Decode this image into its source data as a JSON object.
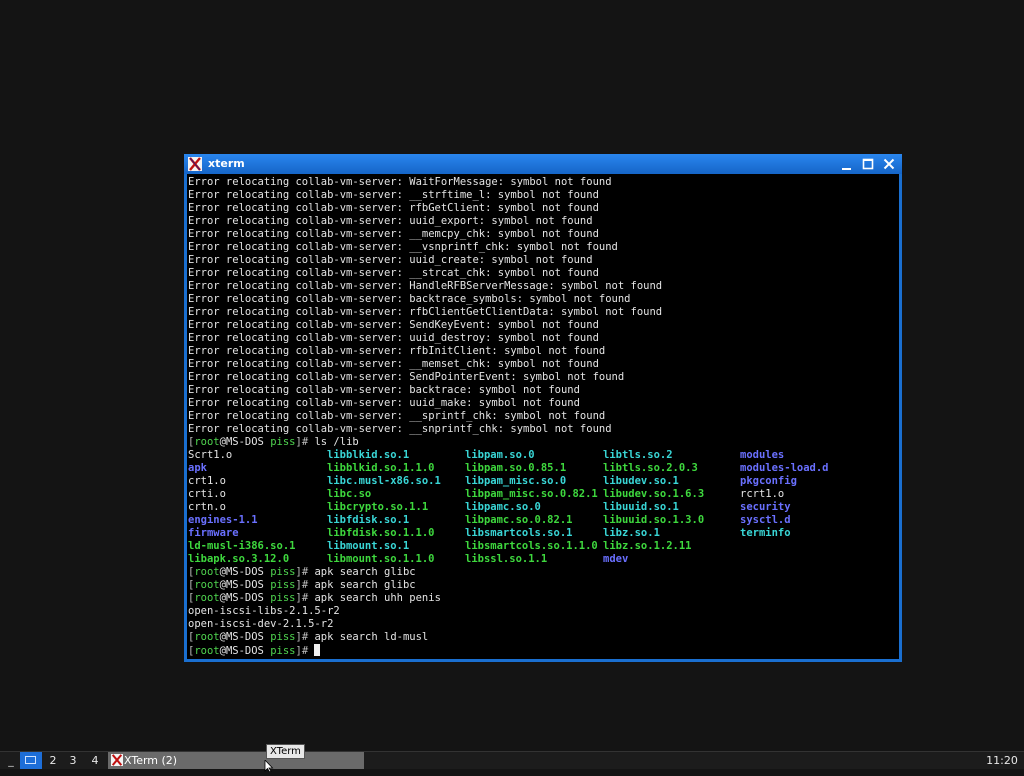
{
  "window": {
    "title": "xterm",
    "icon": "xterm-x-icon",
    "buttons": [
      "minimize",
      "maximize",
      "close"
    ]
  },
  "terminal": {
    "errors": [
      "Error relocating collab-vm-server: WaitForMessage: symbol not found",
      "Error relocating collab-vm-server: __strftime_l: symbol not found",
      "Error relocating collab-vm-server: rfbGetClient: symbol not found",
      "Error relocating collab-vm-server: uuid_export: symbol not found",
      "Error relocating collab-vm-server: __memcpy_chk: symbol not found",
      "Error relocating collab-vm-server: __vsnprintf_chk: symbol not found",
      "Error relocating collab-vm-server: uuid_create: symbol not found",
      "Error relocating collab-vm-server: __strcat_chk: symbol not found",
      "Error relocating collab-vm-server: HandleRFBServerMessage: symbol not found",
      "Error relocating collab-vm-server: backtrace_symbols: symbol not found",
      "Error relocating collab-vm-server: rfbClientGetClientData: symbol not found",
      "Error relocating collab-vm-server: SendKeyEvent: symbol not found",
      "Error relocating collab-vm-server: uuid_destroy: symbol not found",
      "Error relocating collab-vm-server: rfbInitClient: symbol not found",
      "Error relocating collab-vm-server: __memset_chk: symbol not found",
      "Error relocating collab-vm-server: SendPointerEvent: symbol not found",
      "Error relocating collab-vm-server: backtrace: symbol not found",
      "Error relocating collab-vm-server: uuid_make: symbol not found",
      "Error relocating collab-vm-server: __sprintf_chk: symbol not found",
      "Error relocating collab-vm-server: __snprintf_chk: symbol not found"
    ],
    "prompt": {
      "user": "root",
      "host": "MS-DOS",
      "dir": "piss",
      "symbol": "#"
    },
    "ls_command": "ls /lib",
    "ls_rows": [
      [
        [
          "Scrt1.o",
          "file"
        ],
        [
          "libblkid.so.1",
          "link"
        ],
        [
          "libpam.so.0",
          "link"
        ],
        [
          "libtls.so.2",
          "link"
        ],
        [
          "modules",
          "dir"
        ]
      ],
      [
        [
          "apk",
          "dir"
        ],
        [
          "libblkid.so.1.1.0",
          "exec"
        ],
        [
          "libpam.so.0.85.1",
          "exec"
        ],
        [
          "libtls.so.2.0.3",
          "exec"
        ],
        [
          "modules-load.d",
          "dir"
        ]
      ],
      [
        [
          "crt1.o",
          "file"
        ],
        [
          "libc.musl-x86.so.1",
          "link"
        ],
        [
          "libpam_misc.so.0",
          "link"
        ],
        [
          "libudev.so.1",
          "link"
        ],
        [
          "pkgconfig",
          "dir"
        ]
      ],
      [
        [
          "crti.o",
          "file"
        ],
        [
          "libc.so",
          "exec"
        ],
        [
          "libpam_misc.so.0.82.1",
          "exec"
        ],
        [
          "libudev.so.1.6.3",
          "exec"
        ],
        [
          "rcrt1.o",
          "file"
        ]
      ],
      [
        [
          "crtn.o",
          "file"
        ],
        [
          "libcrypto.so.1.1",
          "exec"
        ],
        [
          "libpamc.so.0",
          "link"
        ],
        [
          "libuuid.so.1",
          "link"
        ],
        [
          "security",
          "dir"
        ]
      ],
      [
        [
          "engines-1.1",
          "dir"
        ],
        [
          "libfdisk.so.1",
          "link"
        ],
        [
          "libpamc.so.0.82.1",
          "exec"
        ],
        [
          "libuuid.so.1.3.0",
          "exec"
        ],
        [
          "sysctl.d",
          "dir"
        ]
      ],
      [
        [
          "firmware",
          "dir"
        ],
        [
          "libfdisk.so.1.1.0",
          "exec"
        ],
        [
          "libsmartcols.so.1",
          "link"
        ],
        [
          "libz.so.1",
          "link"
        ],
        [
          "terminfo",
          "link"
        ]
      ],
      [
        [
          "ld-musl-i386.so.1",
          "exec"
        ],
        [
          "libmount.so.1",
          "link"
        ],
        [
          "libsmartcols.so.1.1.0",
          "exec"
        ],
        [
          "libz.so.1.2.11",
          "exec"
        ],
        [
          "",
          ""
        ]
      ],
      [
        [
          "libapk.so.3.12.0",
          "exec"
        ],
        [
          "libmount.so.1.1.0",
          "exec"
        ],
        [
          "libssl.so.1.1",
          "exec"
        ],
        [
          "mdev",
          "dir"
        ],
        [
          "",
          ""
        ]
      ]
    ],
    "after": [
      {
        "type": "prompt",
        "cmd": "apk search glibc"
      },
      {
        "type": "prompt",
        "cmd": "apk search glibc"
      },
      {
        "type": "prompt",
        "cmd": "apk search uhh penis"
      },
      {
        "type": "out",
        "text": "open-iscsi-libs-2.1.5-r2"
      },
      {
        "type": "out",
        "text": "open-iscsi-dev-2.1.5-r2"
      },
      {
        "type": "prompt",
        "cmd": "apk search ld-musl"
      },
      {
        "type": "prompt",
        "cmd": "",
        "cursor": true
      }
    ]
  },
  "taskbar": {
    "dash": "_",
    "desktops": [
      "2",
      "3",
      "4"
    ],
    "active_desktop_icon": "screen-icon",
    "task_label": "XTerm (2)",
    "tooltip": "XTerm",
    "clock": "11:20"
  },
  "colors": {
    "titlebar": "#1a6fd0",
    "desktop": "#141414",
    "dir": "#6a70ff",
    "link": "#39d6d6",
    "exec": "#3ed83e",
    "prompt_green": "#4fd44f"
  }
}
